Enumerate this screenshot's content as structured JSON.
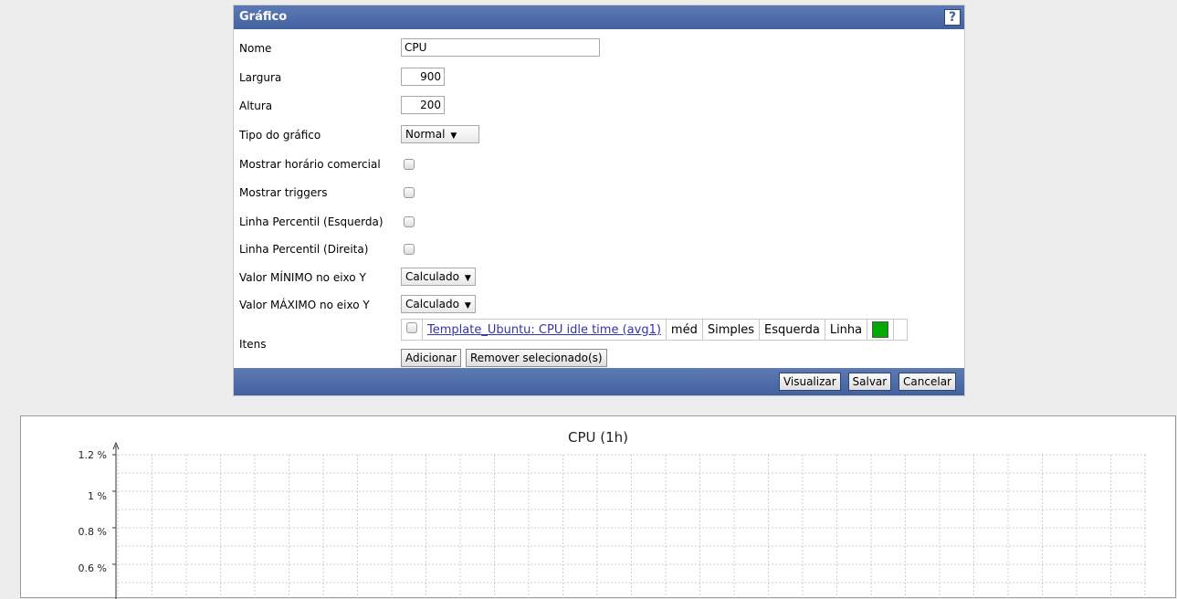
{
  "form": {
    "title": "Gráfico",
    "help_icon": "?",
    "fields": {
      "name_label": "Nome",
      "name_value": "CPU",
      "width_label": "Largura",
      "width_value": "900",
      "height_label": "Altura",
      "height_value": "200",
      "type_label": "Tipo do gráfico",
      "type_value": "Normal",
      "work_time_label": "Mostrar horário comercial",
      "triggers_label": "Mostrar triggers",
      "percentile_left_label": "Linha Percentil (Esquerda)",
      "percentile_right_label": "Linha Percentil (Direita)",
      "ymin_label": "Valor MÍNIMO no eixo Y",
      "ymin_value": "Calculado",
      "ymax_label": "Valor MÁXIMO no eixo Y",
      "ymax_value": "Calculado",
      "items_label": "Itens"
    },
    "items": [
      {
        "name": "Template_Ubuntu: CPU idle time (avg1)",
        "function": "méd",
        "draw_style": "Simples",
        "y_axis": "Esquerda",
        "type": "Linha",
        "color": "#00aa00"
      }
    ],
    "add_button": "Adicionar",
    "remove_button": "Remover selecionado(s)",
    "footer": {
      "preview": "Visualizar",
      "save": "Salvar",
      "cancel": "Cancelar"
    }
  },
  "graph": {
    "title": "CPU  (1h)",
    "y_ticks": [
      "1.2 %",
      "1 %",
      "0.8 %",
      "0.6 %"
    ]
  }
}
